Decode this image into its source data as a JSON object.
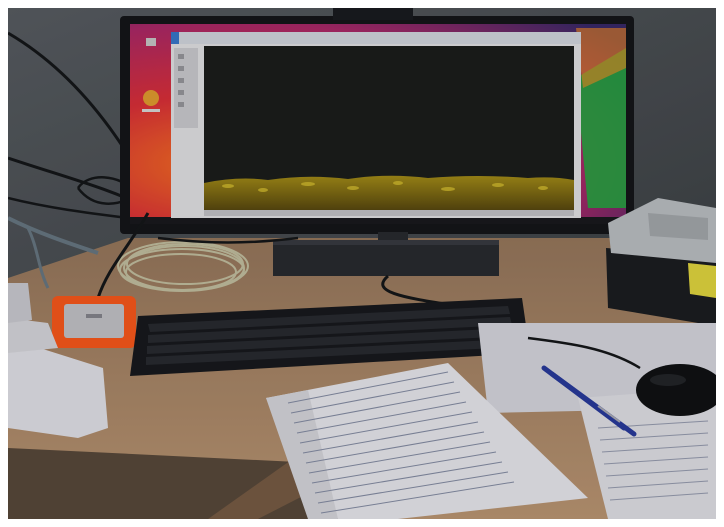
{
  "scene": {
    "description_tags": [
      "monitor",
      "keyboard",
      "mouse",
      "external-drive",
      "cable-coil",
      "papers",
      "pens",
      "tool-case",
      "desk"
    ]
  },
  "screen": {
    "wallpaper_colors": [
      "#ff5a2a",
      "#e0303a",
      "#ff9a20",
      "#20c040",
      "#c040a0"
    ],
    "app_window_bg": "#1c1e1c",
    "sediment_color": "#c8b020"
  },
  "colors": {
    "desk": "#b08a68",
    "wall": "#4e5256",
    "drive_orange": "#ff5a1c",
    "keyboard": "#181a1e",
    "mouse": "#101214"
  }
}
